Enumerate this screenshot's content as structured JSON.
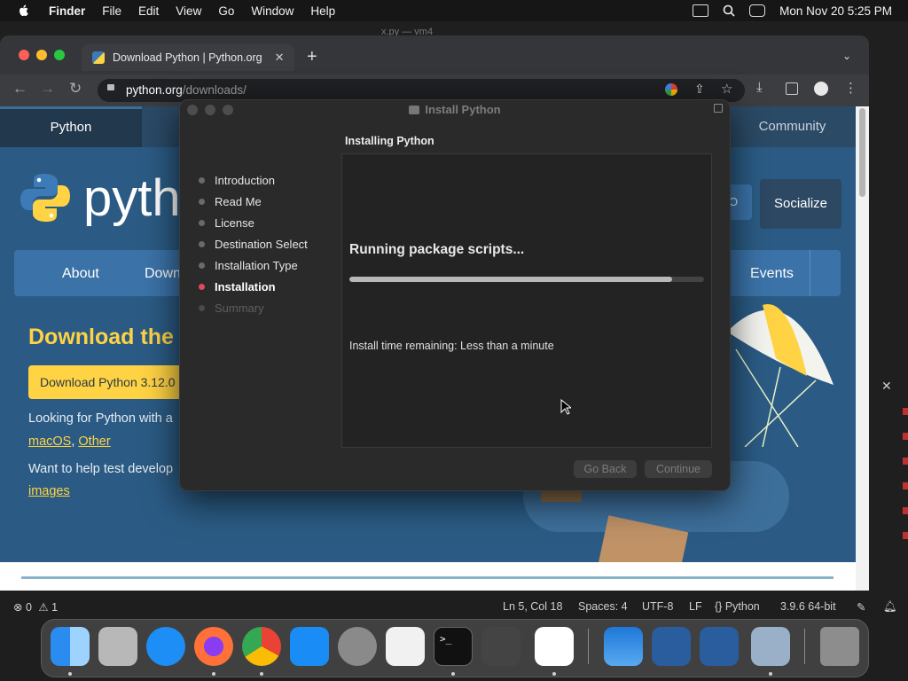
{
  "menubar": {
    "app": "Finder",
    "items": [
      "File",
      "Edit",
      "View",
      "Go",
      "Window",
      "Help"
    ],
    "datetime": "Mon Nov 20  5:25 PM"
  },
  "browser": {
    "tab_title": "Download Python | Python.org",
    "url_host": "python.org",
    "url_path": "/downloads/"
  },
  "webpage": {
    "nav_top": [
      "Python",
      "Community"
    ],
    "logo_text": "pytho",
    "socialize": "Socialize",
    "nav_main": [
      "About",
      "Down",
      "Events"
    ],
    "headline": "Download the",
    "download_button": "Download Python 3.12.0",
    "looking_text": "Looking for Python with a",
    "links": [
      "macOS",
      "Other"
    ],
    "help_text": "Want to help test develop",
    "images_link": "images"
  },
  "installer": {
    "title": "Install Python",
    "section_title": "Installing Python",
    "steps": [
      {
        "label": "Introduction",
        "state": "done"
      },
      {
        "label": "Read Me",
        "state": "done"
      },
      {
        "label": "License",
        "state": "done"
      },
      {
        "label": "Destination Select",
        "state": "done"
      },
      {
        "label": "Installation Type",
        "state": "done"
      },
      {
        "label": "Installation",
        "state": "active"
      },
      {
        "label": "Summary",
        "state": "pending"
      }
    ],
    "status": "Running package scripts...",
    "progress": 0.91,
    "time_remaining": "Install time remaining: Less than a minute",
    "go_back": "Go Back",
    "continue": "Continue"
  },
  "statusbar": {
    "errors": "0",
    "warnings": "1",
    "position": "Ln 5, Col 18",
    "spaces": "Spaces: 4",
    "encoding": "UTF-8",
    "eol": "LF",
    "language": "Python",
    "interpreter": "3.9.6 64-bit"
  },
  "vscode_title": "x.py — vm4",
  "dock": [
    "finder-icon",
    "launchpad-icon",
    "safari-icon",
    "firefox-icon",
    "chrome-icon",
    "app-store-icon",
    "system-preferences-icon",
    "textedit-icon",
    "terminal-icon",
    "garageband-icon",
    "vscode-icon",
    "weather-icon",
    "virtualbox-icon",
    "virtualbox-vm-icon",
    "downloads-icon",
    "trash-icon"
  ],
  "colors": {
    "accent_active_step": "#e0485c",
    "python_yellow": "#ffd343",
    "python_blue": "#2b5b84"
  }
}
